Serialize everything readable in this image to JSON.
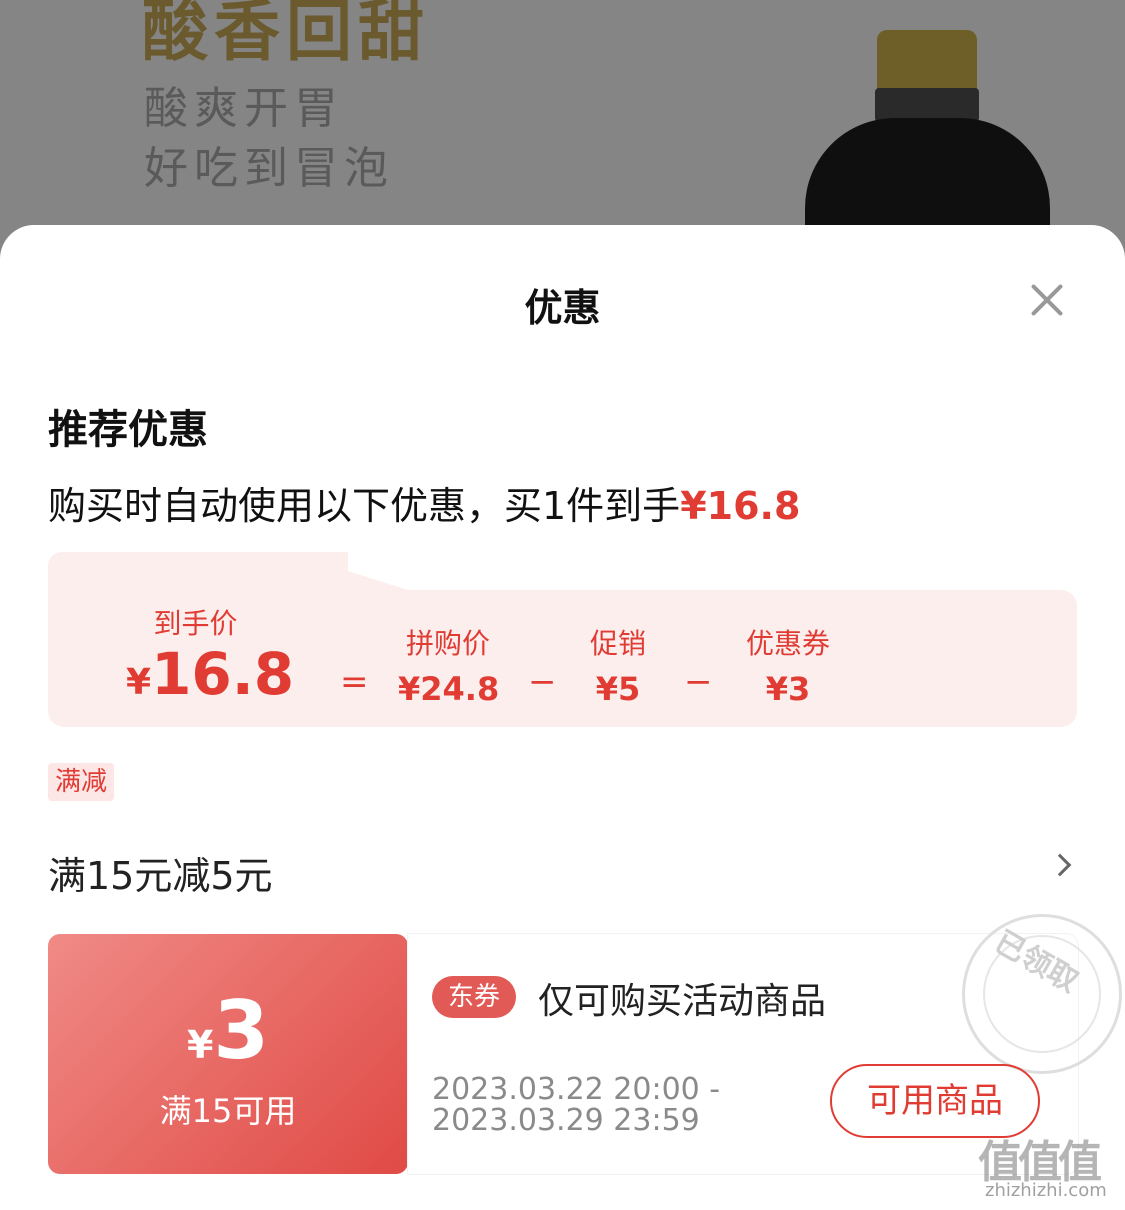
{
  "background": {
    "title": "酸香回甜",
    "line1": "酸爽开胃",
    "line2": "好吃到冒泡"
  },
  "sheet": {
    "title": "优惠"
  },
  "recommend": {
    "title": "推荐优惠",
    "summary_prefix": "购买时自动使用以下优惠，买1件到手",
    "summary_price": "¥16.8"
  },
  "breakdown": {
    "final_label": "到手价",
    "final_yen": "¥",
    "final_value": "16.8",
    "eq": "=",
    "minus": "−",
    "group_price_label": "拼购价",
    "group_price_value": "¥24.8",
    "promo_label": "促销",
    "promo_value": "¥5",
    "coupon_label": "优惠券",
    "coupon_value": "¥3"
  },
  "promo": {
    "tag": "满减",
    "text": "满15元减5元"
  },
  "coupon": {
    "yen": "¥",
    "amount": "3",
    "condition": "满15可用",
    "badge": "东券",
    "description": "仅可购买活动商品",
    "date_line1": "2023.03.22 20:00 -",
    "date_line2": "2023.03.29 23:59",
    "button": "可用商品",
    "stamp": "已领取"
  },
  "watermark": {
    "logo": "值值值",
    "url": "zhizhizhi.com"
  },
  "colors": {
    "accent": "#e03c33",
    "card_bg": "#fdeeee"
  }
}
